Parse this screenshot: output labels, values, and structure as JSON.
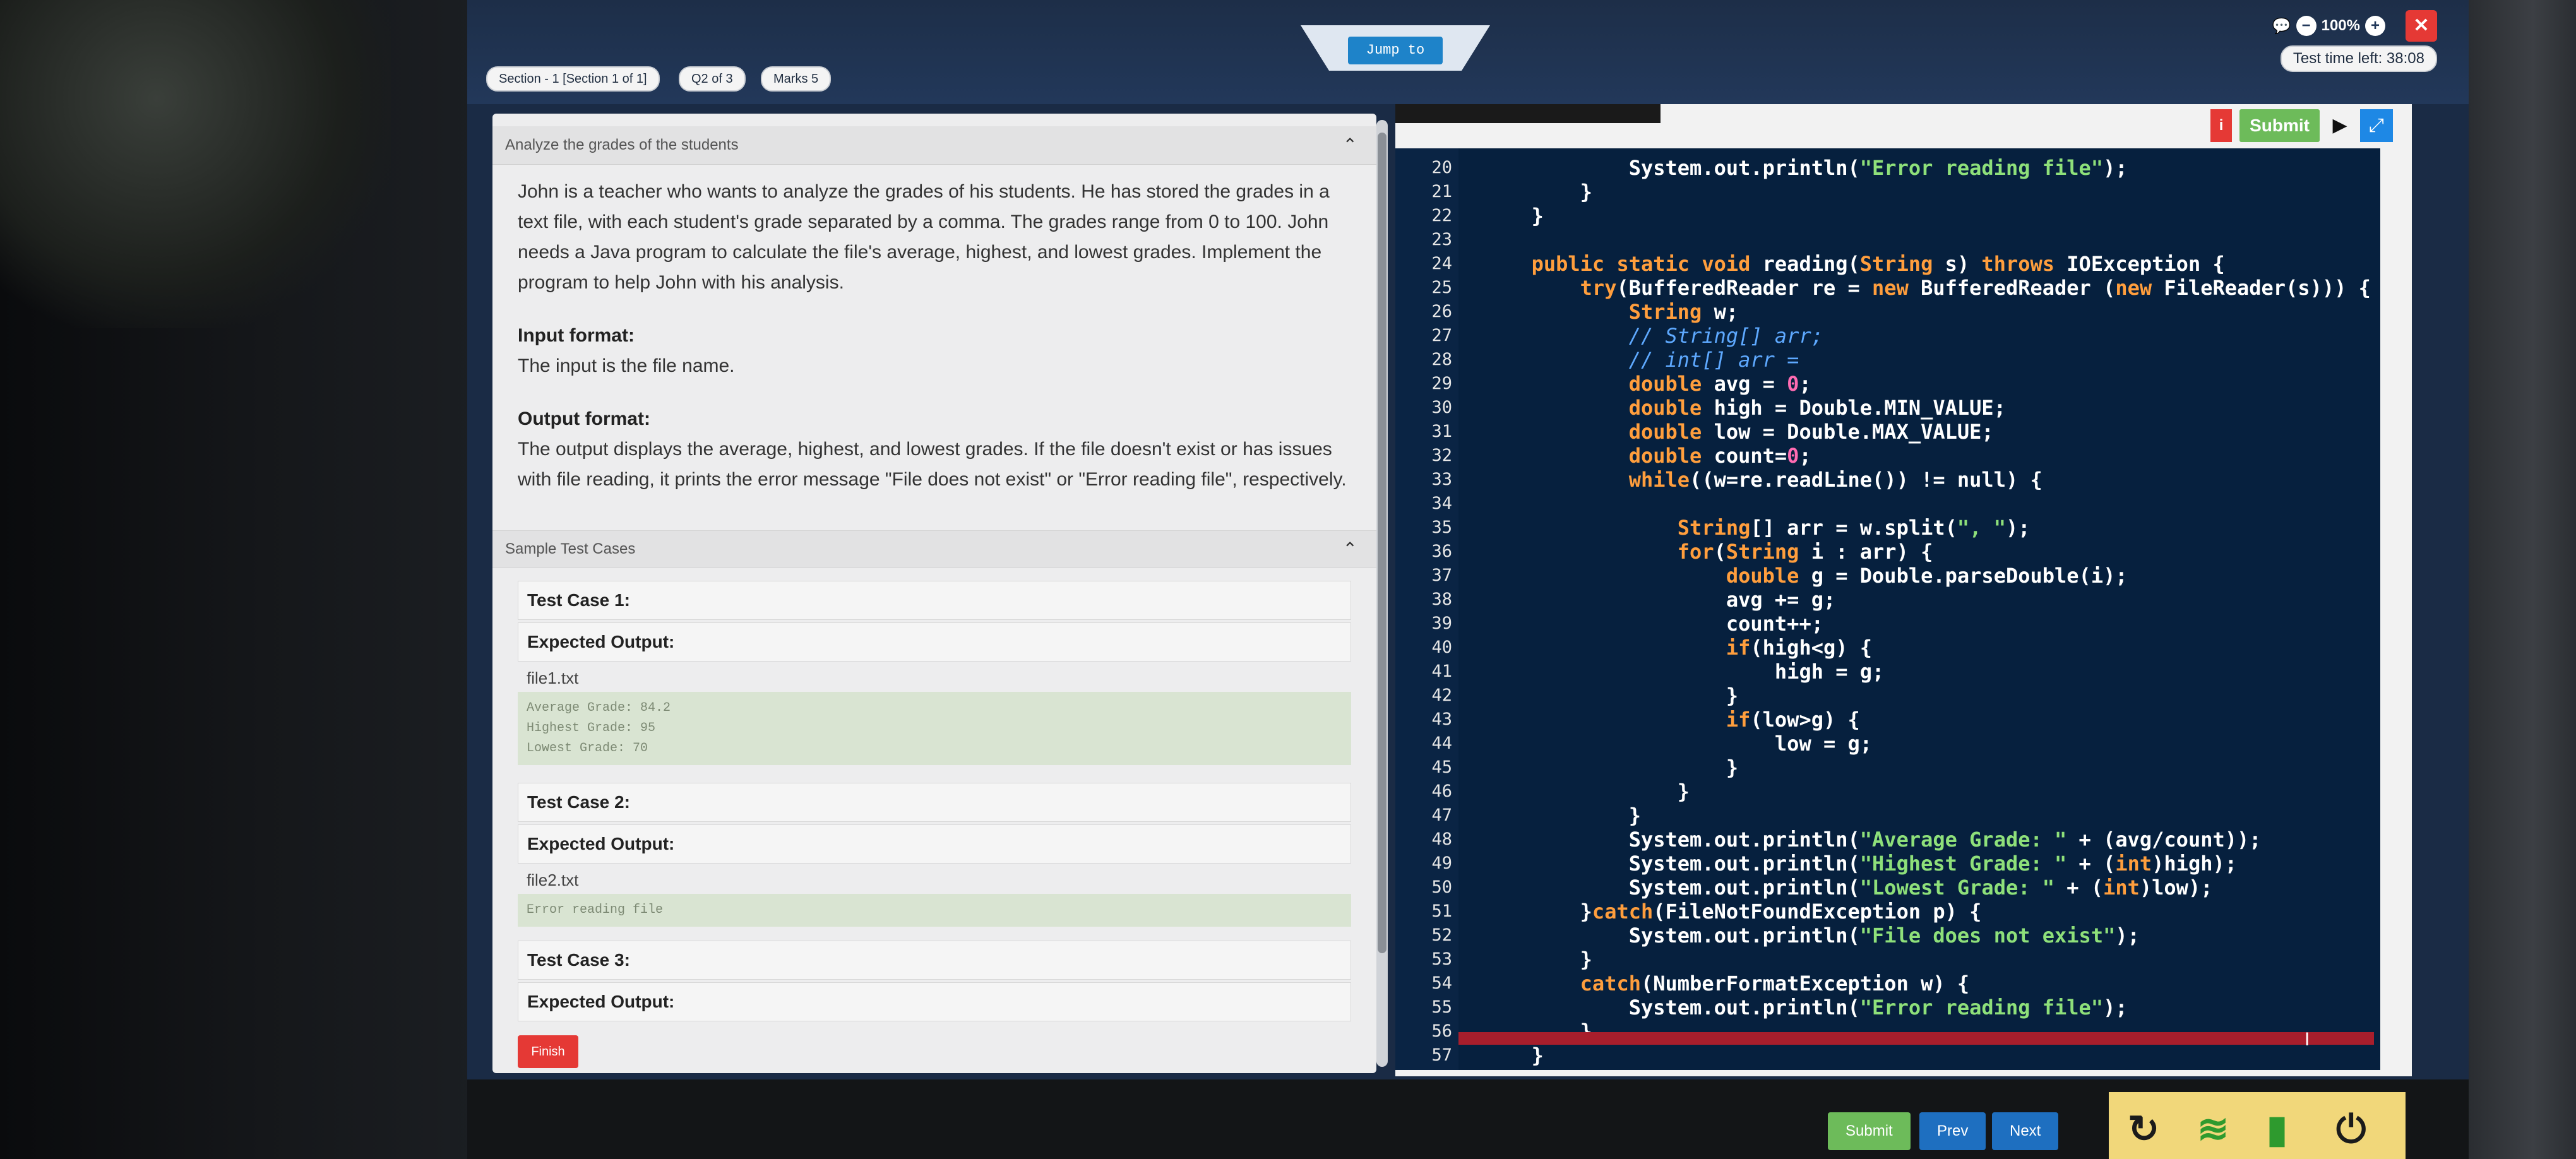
{
  "header": {
    "section_label": "Section - 1 [Section 1 of 1]",
    "question_label": "Q2 of 3",
    "marks_label": "Marks 5",
    "jump_label": "Jump to",
    "zoom_label": "100%",
    "timer_label": "Test time left: 38:08"
  },
  "problem": {
    "panel_title": "Analyze the grades of the students",
    "description": "John is a teacher who wants to analyze the grades of his students. He has stored the grades in a text file, with each student's grade separated by a comma. The grades range from 0 to 100. John needs a Java program to calculate the file's average, highest, and lowest grades. Implement the program to help John with his analysis.",
    "input_heading": "Input format:",
    "input_text": "The input is the file name.",
    "output_heading": "Output format:",
    "output_text": "The output displays the average, highest, and lowest grades. If the file doesn't exist or has issues with file reading, it prints the error message \"File does not exist\" or \"Error reading file\", respectively."
  },
  "test_cases": {
    "panel_title": "Sample Test Cases",
    "cases": [
      {
        "title": "Test Case 1:",
        "expected_label": "Expected Output:",
        "file": "file1.txt",
        "output": [
          "Average Grade: 84.2",
          "Highest Grade: 95",
          "Lowest Grade: 70"
        ]
      },
      {
        "title": "Test Case 2:",
        "expected_label": "Expected Output:",
        "file": "file2.txt",
        "output": [
          "Error reading file"
        ]
      },
      {
        "title": "Test Case 3:",
        "expected_label": "Expected Output:"
      }
    ]
  },
  "footer": {
    "finish_label": "Finish",
    "submit_label": "Submit",
    "prev_label": "Prev",
    "next_label": "Next"
  },
  "editor": {
    "submit_label": "Submit",
    "info_label": "i",
    "lines": [
      {
        "n": "20",
        "code": "            System.out.println(\"Error reading file\");"
      },
      {
        "n": "21",
        "code": "        }"
      },
      {
        "n": "22",
        "code": "    }"
      },
      {
        "n": "23",
        "code": ""
      },
      {
        "n": "24",
        "code": "    public static void reading(String s) throws IOException {"
      },
      {
        "n": "25",
        "code": "        try(BufferedReader re = new BufferedReader (new FileReader(s))) {"
      },
      {
        "n": "26",
        "code": "            String w;"
      },
      {
        "n": "27",
        "code": "            // String[] arr;"
      },
      {
        "n": "28",
        "code": "            // int[] arr ="
      },
      {
        "n": "29",
        "code": "            double avg = 0;"
      },
      {
        "n": "30",
        "code": "            double high = Double.MIN_VALUE;"
      },
      {
        "n": "31",
        "code": "            double low = Double.MAX_VALUE;"
      },
      {
        "n": "32",
        "code": "            double count=0;"
      },
      {
        "n": "33",
        "code": "            while((w=re.readLine()) != null) {"
      },
      {
        "n": "34",
        "code": ""
      },
      {
        "n": "35",
        "code": "                String[] arr = w.split(\", \");"
      },
      {
        "n": "36",
        "code": "                for(String i : arr) {"
      },
      {
        "n": "37",
        "code": "                    double g = Double.parseDouble(i);"
      },
      {
        "n": "38",
        "code": "                    avg += g;"
      },
      {
        "n": "39",
        "code": "                    count++;"
      },
      {
        "n": "40",
        "code": "                    if(high<g) {"
      },
      {
        "n": "41",
        "code": "                        high = g;"
      },
      {
        "n": "42",
        "code": "                    }"
      },
      {
        "n": "43",
        "code": "                    if(low>g) {"
      },
      {
        "n": "44",
        "code": "                        low = g;"
      },
      {
        "n": "45",
        "code": "                    }"
      },
      {
        "n": "46",
        "code": "                }"
      },
      {
        "n": "47",
        "code": "            }"
      },
      {
        "n": "48",
        "code": "            System.out.println(\"Average Grade: \" + (avg/count));"
      },
      {
        "n": "49",
        "code": "            System.out.println(\"Highest Grade: \" + (int)high);"
      },
      {
        "n": "50",
        "code": "            System.out.println(\"Lowest Grade: \" + (int)low);"
      },
      {
        "n": "51",
        "code": "        }catch(FileNotFoundException p) {"
      },
      {
        "n": "52",
        "code": "            System.out.println(\"File does not exist\");"
      },
      {
        "n": "53",
        "code": "        }"
      },
      {
        "n": "54",
        "code": "        catch(NumberFormatException w) {"
      },
      {
        "n": "55",
        "code": "            System.out.println(\"Error reading file\");"
      },
      {
        "n": "56",
        "code": "        }"
      },
      {
        "n": "57",
        "code": "    }"
      }
    ]
  },
  "colors": {
    "topbar": "#22385a",
    "editor_bg": "#06203e",
    "accent_blue": "#1e83c9",
    "submit_green": "#6dbb5a",
    "danger_red": "#e53935"
  }
}
